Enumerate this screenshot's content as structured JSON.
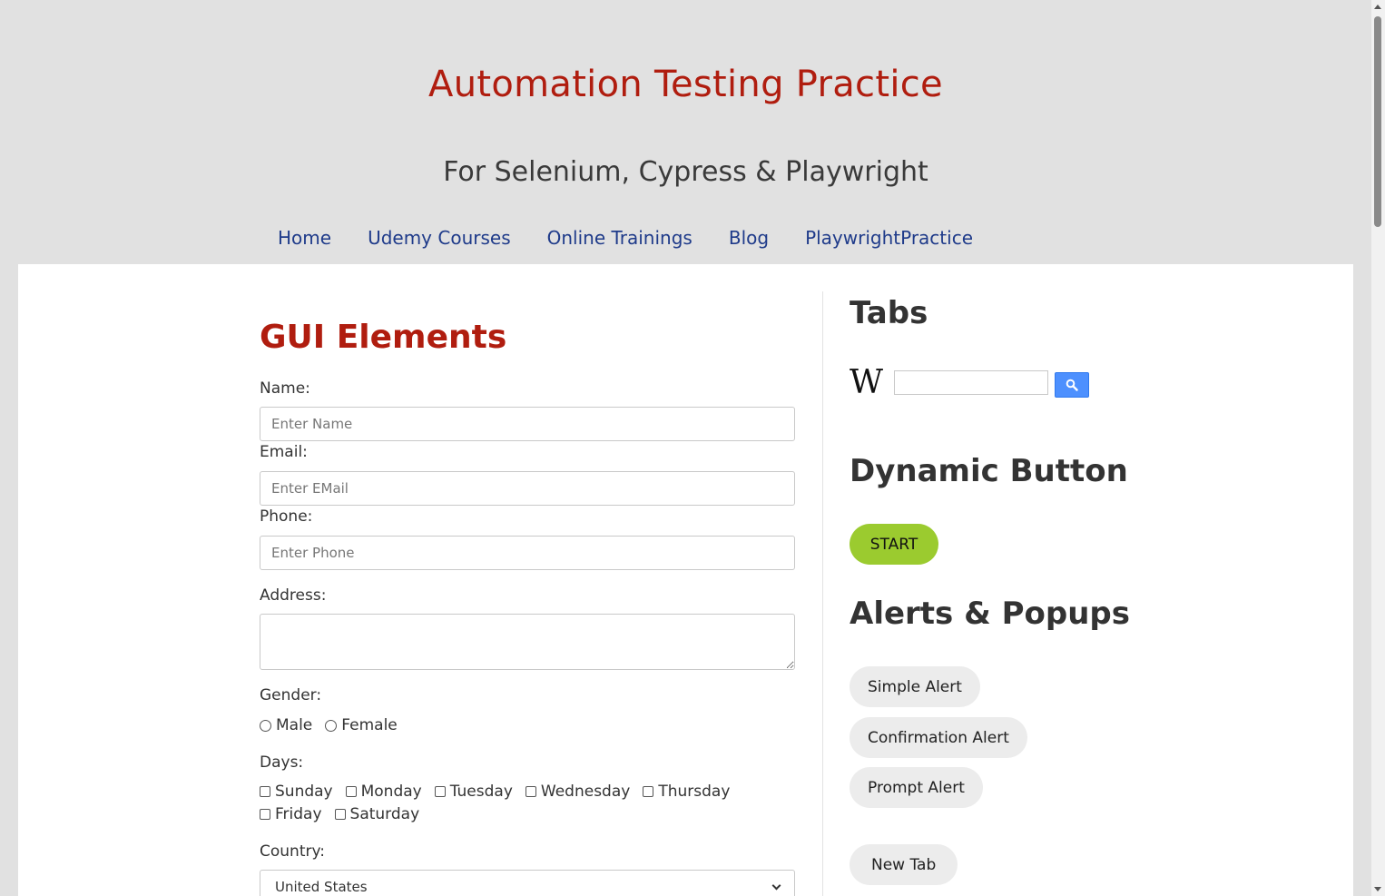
{
  "header": {
    "title": "Automation Testing Practice",
    "description": "For Selenium, Cypress & Playwright"
  },
  "nav": {
    "items": [
      "Home",
      "Udemy Courses",
      "Online Trainings",
      "Blog",
      "PlaywrightPractice"
    ]
  },
  "form": {
    "title": "GUI Elements",
    "name_label": "Name:",
    "name_placeholder": "Enter Name",
    "email_label": "Email:",
    "email_placeholder": "Enter EMail",
    "phone_label": "Phone:",
    "phone_placeholder": "Enter Phone",
    "address_label": "Address:",
    "gender_label": "Gender:",
    "gender_options": [
      "Male",
      "Female"
    ],
    "days_label": "Days:",
    "days": [
      "Sunday",
      "Monday",
      "Tuesday",
      "Wednesday",
      "Thursday",
      "Friday",
      "Saturday"
    ],
    "country_label": "Country:",
    "country_selected": "United States"
  },
  "sidebar": {
    "tabs_title": "Tabs",
    "wiki_logo": "W",
    "dynamic_title": "Dynamic Button",
    "start_label": "START",
    "alerts_title": "Alerts & Popups",
    "simple_alert": "Simple Alert",
    "confirmation_alert": "Confirmation Alert",
    "prompt_alert": "Prompt Alert",
    "new_tab": "New Tab"
  },
  "colors": {
    "title_red": "#b01d0f",
    "nav_blue": "#1f3b8a",
    "start_green": "#9bcb2f",
    "search_blue": "#4d90fe"
  },
  "icons": {
    "search": "search-icon",
    "chevron": "chevron-down-icon"
  }
}
